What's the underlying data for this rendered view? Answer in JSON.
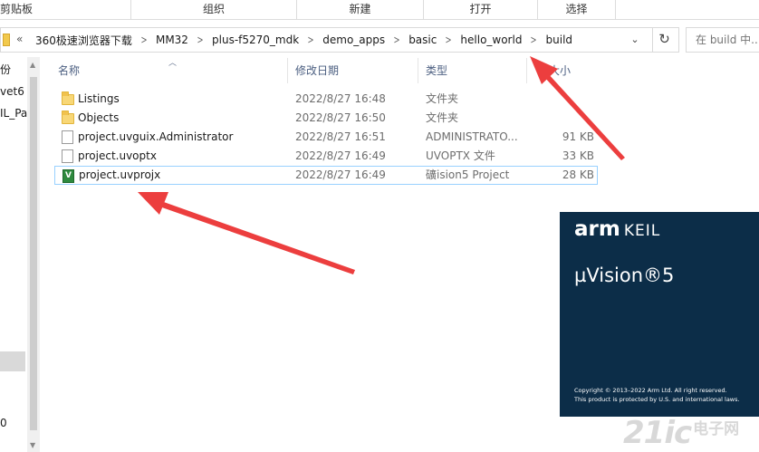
{
  "ribbon": {
    "groups": [
      "剪贴板",
      "组织",
      "新建",
      "打开",
      "选择"
    ]
  },
  "address": {
    "crumbs": [
      "360极速浏览器下载",
      "MM32",
      "plus-f5270_mdk",
      "demo_apps",
      "basic",
      "hello_world",
      "build"
    ],
    "overflow": "«",
    "dropdown_icon": "chevron-down-icon",
    "refresh_icon": "refresh-icon",
    "search_placeholder": "在 build 中..."
  },
  "nav": {
    "items": [
      "份",
      "vet6",
      "IL_Pa",
      "0"
    ]
  },
  "columns": {
    "name": "名称",
    "date": "修改日期",
    "type": "类型",
    "size": "大小"
  },
  "files": [
    {
      "name": "Listings",
      "date": "2022/8/27 16:48",
      "type": "文件夹",
      "size": "",
      "icon": "folder-icon",
      "selected": false
    },
    {
      "name": "Objects",
      "date": "2022/8/27 16:50",
      "type": "文件夹",
      "size": "",
      "icon": "folder-icon",
      "selected": false
    },
    {
      "name": "project.uvguix.Administrator",
      "date": "2022/8/27 16:51",
      "type": "ADMINISTRATO...",
      "size": "91 KB",
      "icon": "file-icon",
      "selected": false
    },
    {
      "name": "project.uvoptx",
      "date": "2022/8/27 16:49",
      "type": "UVOPTX 文件",
      "size": "33 KB",
      "icon": "file-icon",
      "selected": false
    },
    {
      "name": "project.uvprojx",
      "date": "2022/8/27 16:49",
      "type": "礦ision5 Project",
      "size": "28 KB",
      "icon": "uvision-icon",
      "selected": true
    }
  ],
  "splash": {
    "logo_arm": "arm",
    "logo_keil": "KEIL",
    "product": "µVision®5",
    "copyright": "Copyright © 2013–2022 Arm Ltd. All right reserved.",
    "protection": "This product is protected by U.S. and international laws.",
    "bg_color": "#0c2d48"
  },
  "watermark": {
    "site": "21ic",
    "suffix": "电子网"
  },
  "annotation_color": "#ec3e3e"
}
